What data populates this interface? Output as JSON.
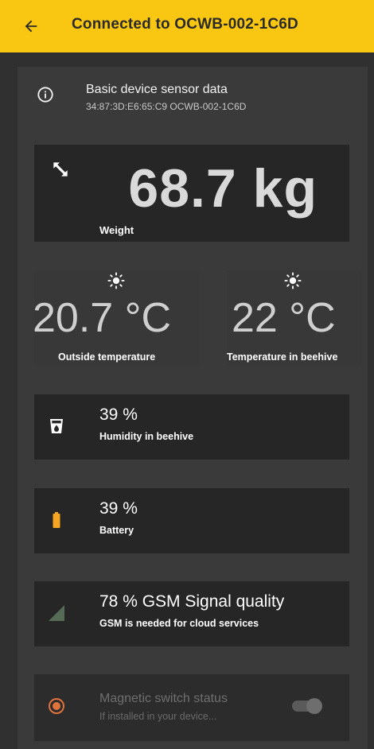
{
  "appbar": {
    "title": "Connected to OCWB-002-1C6D",
    "back_icon": "arrow-left-icon",
    "color": "#f9c712"
  },
  "header": {
    "title": "Basic device sensor data",
    "subtitle": "34:87:3D:E6:65:C9 OCWB-002-1C6D",
    "icon": "info-icon"
  },
  "weight": {
    "value": "68.7 kg",
    "label": "Weight",
    "icon": "expand-arrows-icon"
  },
  "outside_temp": {
    "value": "20.7 °C",
    "label": "Outside temperature",
    "icon": "sun-icon"
  },
  "beehive_temp": {
    "value": "22 °C",
    "label": "Temperature in beehive",
    "icon": "sun-icon"
  },
  "humidity": {
    "value": "39 %",
    "label": "Humidity in beehive",
    "icon": "water-cup-icon"
  },
  "battery": {
    "value": "39 %",
    "label": "Battery",
    "icon": "battery-icon",
    "color": "#f5a623"
  },
  "gsm": {
    "value": "78 % GSM Signal quality",
    "label": "GSM is needed for cloud services",
    "icon": "signal-icon",
    "color": "#556b55"
  },
  "magnetic_switch": {
    "title": "Magnetic switch status",
    "subtitle": "If installed in your device...",
    "icon": "radio-icon",
    "color": "#e0733c",
    "enabled": false
  }
}
